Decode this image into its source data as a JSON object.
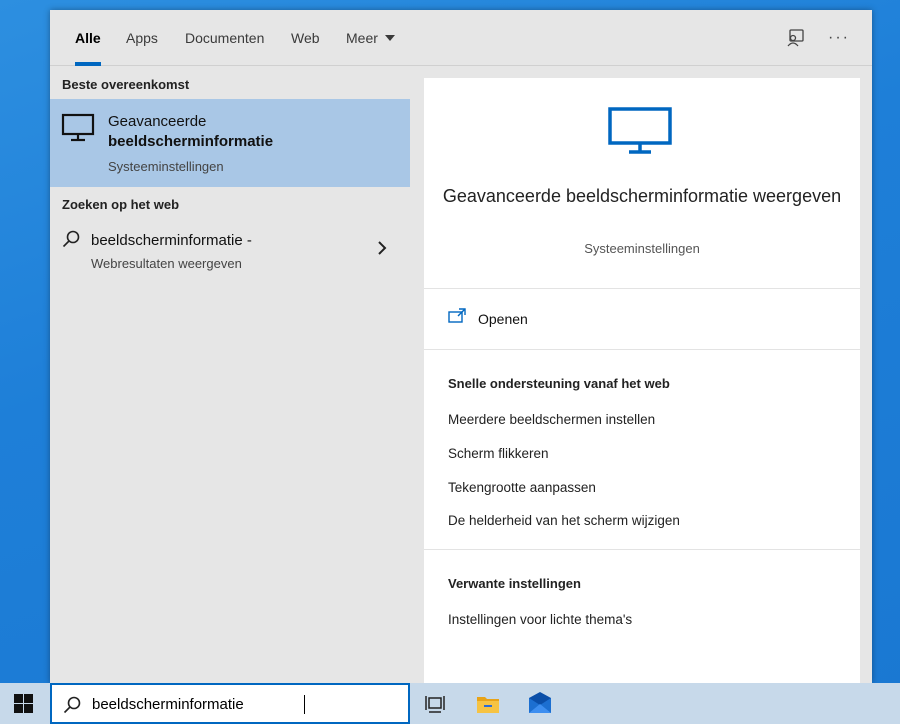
{
  "tabs": [
    {
      "label": "Alle",
      "active": true
    },
    {
      "label": "Apps",
      "active": false
    },
    {
      "label": "Documenten",
      "active": false
    },
    {
      "label": "Web",
      "active": false
    },
    {
      "label": "Meer",
      "active": false
    }
  ],
  "top_icons": {
    "feedback": "feedback-icon",
    "more": "more-options-icon",
    "more_glyph": "···"
  },
  "left": {
    "best_match_heading": "Beste overeenkomst",
    "best_match": {
      "icon": "monitor-icon",
      "title_line1": "Geavanceerde",
      "title_line2": "beeldscherminformatie",
      "subtitle": "Systeeminstellingen"
    },
    "web_heading": "Zoeken op het web",
    "web_result": {
      "icon": "search-icon",
      "title": "beeldscherminformatie -",
      "subtitle": "Webresultaten weergeven"
    }
  },
  "preview": {
    "icon": "monitor-icon",
    "title": "Geavanceerde beeldscherminformatie weergeven",
    "subtitle": "Systeeminstellingen",
    "open_label": "Openen",
    "help_heading": "Snelle ondersteuning vanaf het web",
    "help_links": [
      "Meerdere beeldschermen instellen",
      "Scherm flikkeren",
      "Tekengrootte aanpassen",
      "De helderheid van het scherm wijzigen"
    ],
    "related_heading": "Verwante instellingen",
    "related_links": [
      "Instellingen voor lichte thema's"
    ]
  },
  "taskbar": {
    "search_value": "beeldscherminformatie",
    "icons": [
      "windows-start-icon",
      "task-view-icon",
      "file-explorer-icon",
      "mail-icon"
    ]
  },
  "colors": {
    "accent": "#0067c0",
    "selection": "#a9c7e6",
    "desktop": "#1e7fd8"
  }
}
